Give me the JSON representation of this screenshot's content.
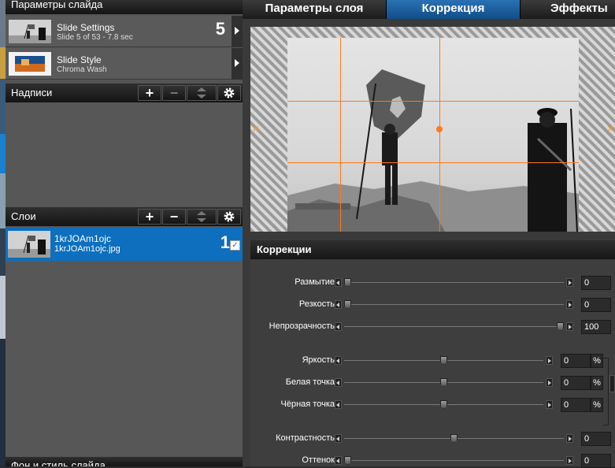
{
  "left": {
    "slide_params_title": "Параметры слайда",
    "slide_settings": {
      "title": "Slide Settings",
      "subtitle": "Slide 5 of 53 - 7.8 sec",
      "number": "5"
    },
    "slide_style": {
      "title": "Slide Style",
      "subtitle": "Chroma Wash"
    },
    "captions_title": "Надписи",
    "layers_title": "Слои",
    "layer": {
      "name": "1krJOAm1ojc",
      "file": "1krJOAm1ojc.jpg",
      "number": "1",
      "checked": true
    },
    "bottom_title": "Фон и стиль слайда"
  },
  "tabs": [
    {
      "label": "Параметры слоя",
      "active": false
    },
    {
      "label": "Коррекция",
      "active": true
    },
    {
      "label": "Эффекты",
      "active": false
    }
  ],
  "correction": {
    "title": "Коррекции",
    "rows": [
      {
        "label": "Размытие",
        "value": "0",
        "position": 0.0
      },
      {
        "label": "Резкость",
        "value": "0",
        "position": 0.0
      },
      {
        "label": "Непрозрачность",
        "value": "100",
        "position": 1.0
      },
      {
        "label": "Яркость",
        "value": "0",
        "unit": "%",
        "position": 0.5
      },
      {
        "label": "Белая точка",
        "value": "0",
        "unit": "%",
        "position": 0.5
      },
      {
        "label": "Чёрная точка",
        "value": "0",
        "unit": "%",
        "position": 0.5
      },
      {
        "label": "Контрастность",
        "value": "0",
        "position": 0.5
      },
      {
        "label": "Оттенок",
        "value": "0",
        "position": 0.0
      }
    ]
  },
  "colors": {
    "accent": "#0d6fbe",
    "tab_active": "#1a5f9e",
    "guide": "#ff7a1a"
  }
}
